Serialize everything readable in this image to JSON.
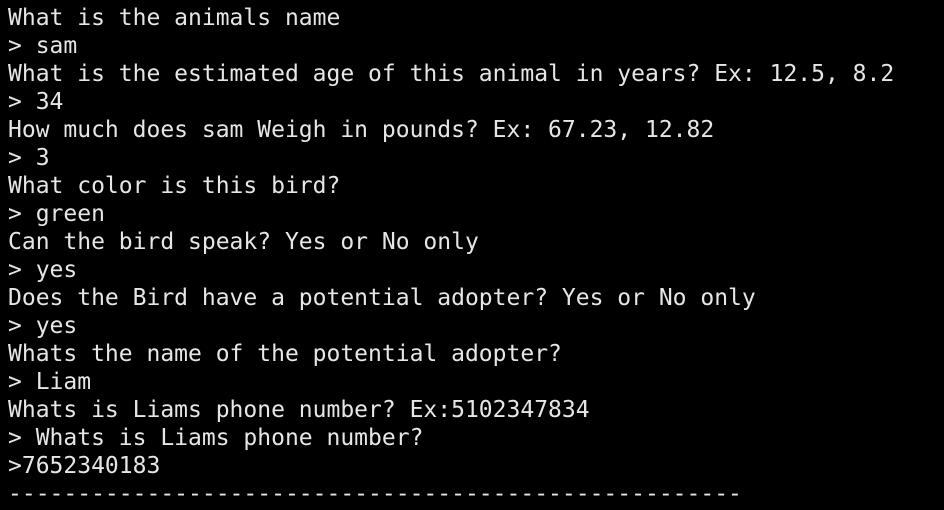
{
  "terminal": {
    "text_color": "#e6e6e6",
    "background_color": "#000000",
    "lines": [
      "What is the animals name",
      "> sam",
      "What is the estimated age of this animal in years? Ex: 12.5, 8.2",
      "> 34",
      "How much does sam Weigh in pounds? Ex: 67.23, 12.82",
      "> 3",
      "What color is this bird?",
      "> green",
      "Can the bird speak? Yes or No only",
      "> yes",
      "Does the Bird have a potential adopter? Yes or No only",
      "> yes",
      "Whats the name of the potential adopter?",
      "> Liam",
      "Whats is Liams phone number? Ex:5102347834",
      "> Whats is Liams phone number?",
      ">7652340183",
      "-----------------------------------------------------"
    ]
  }
}
